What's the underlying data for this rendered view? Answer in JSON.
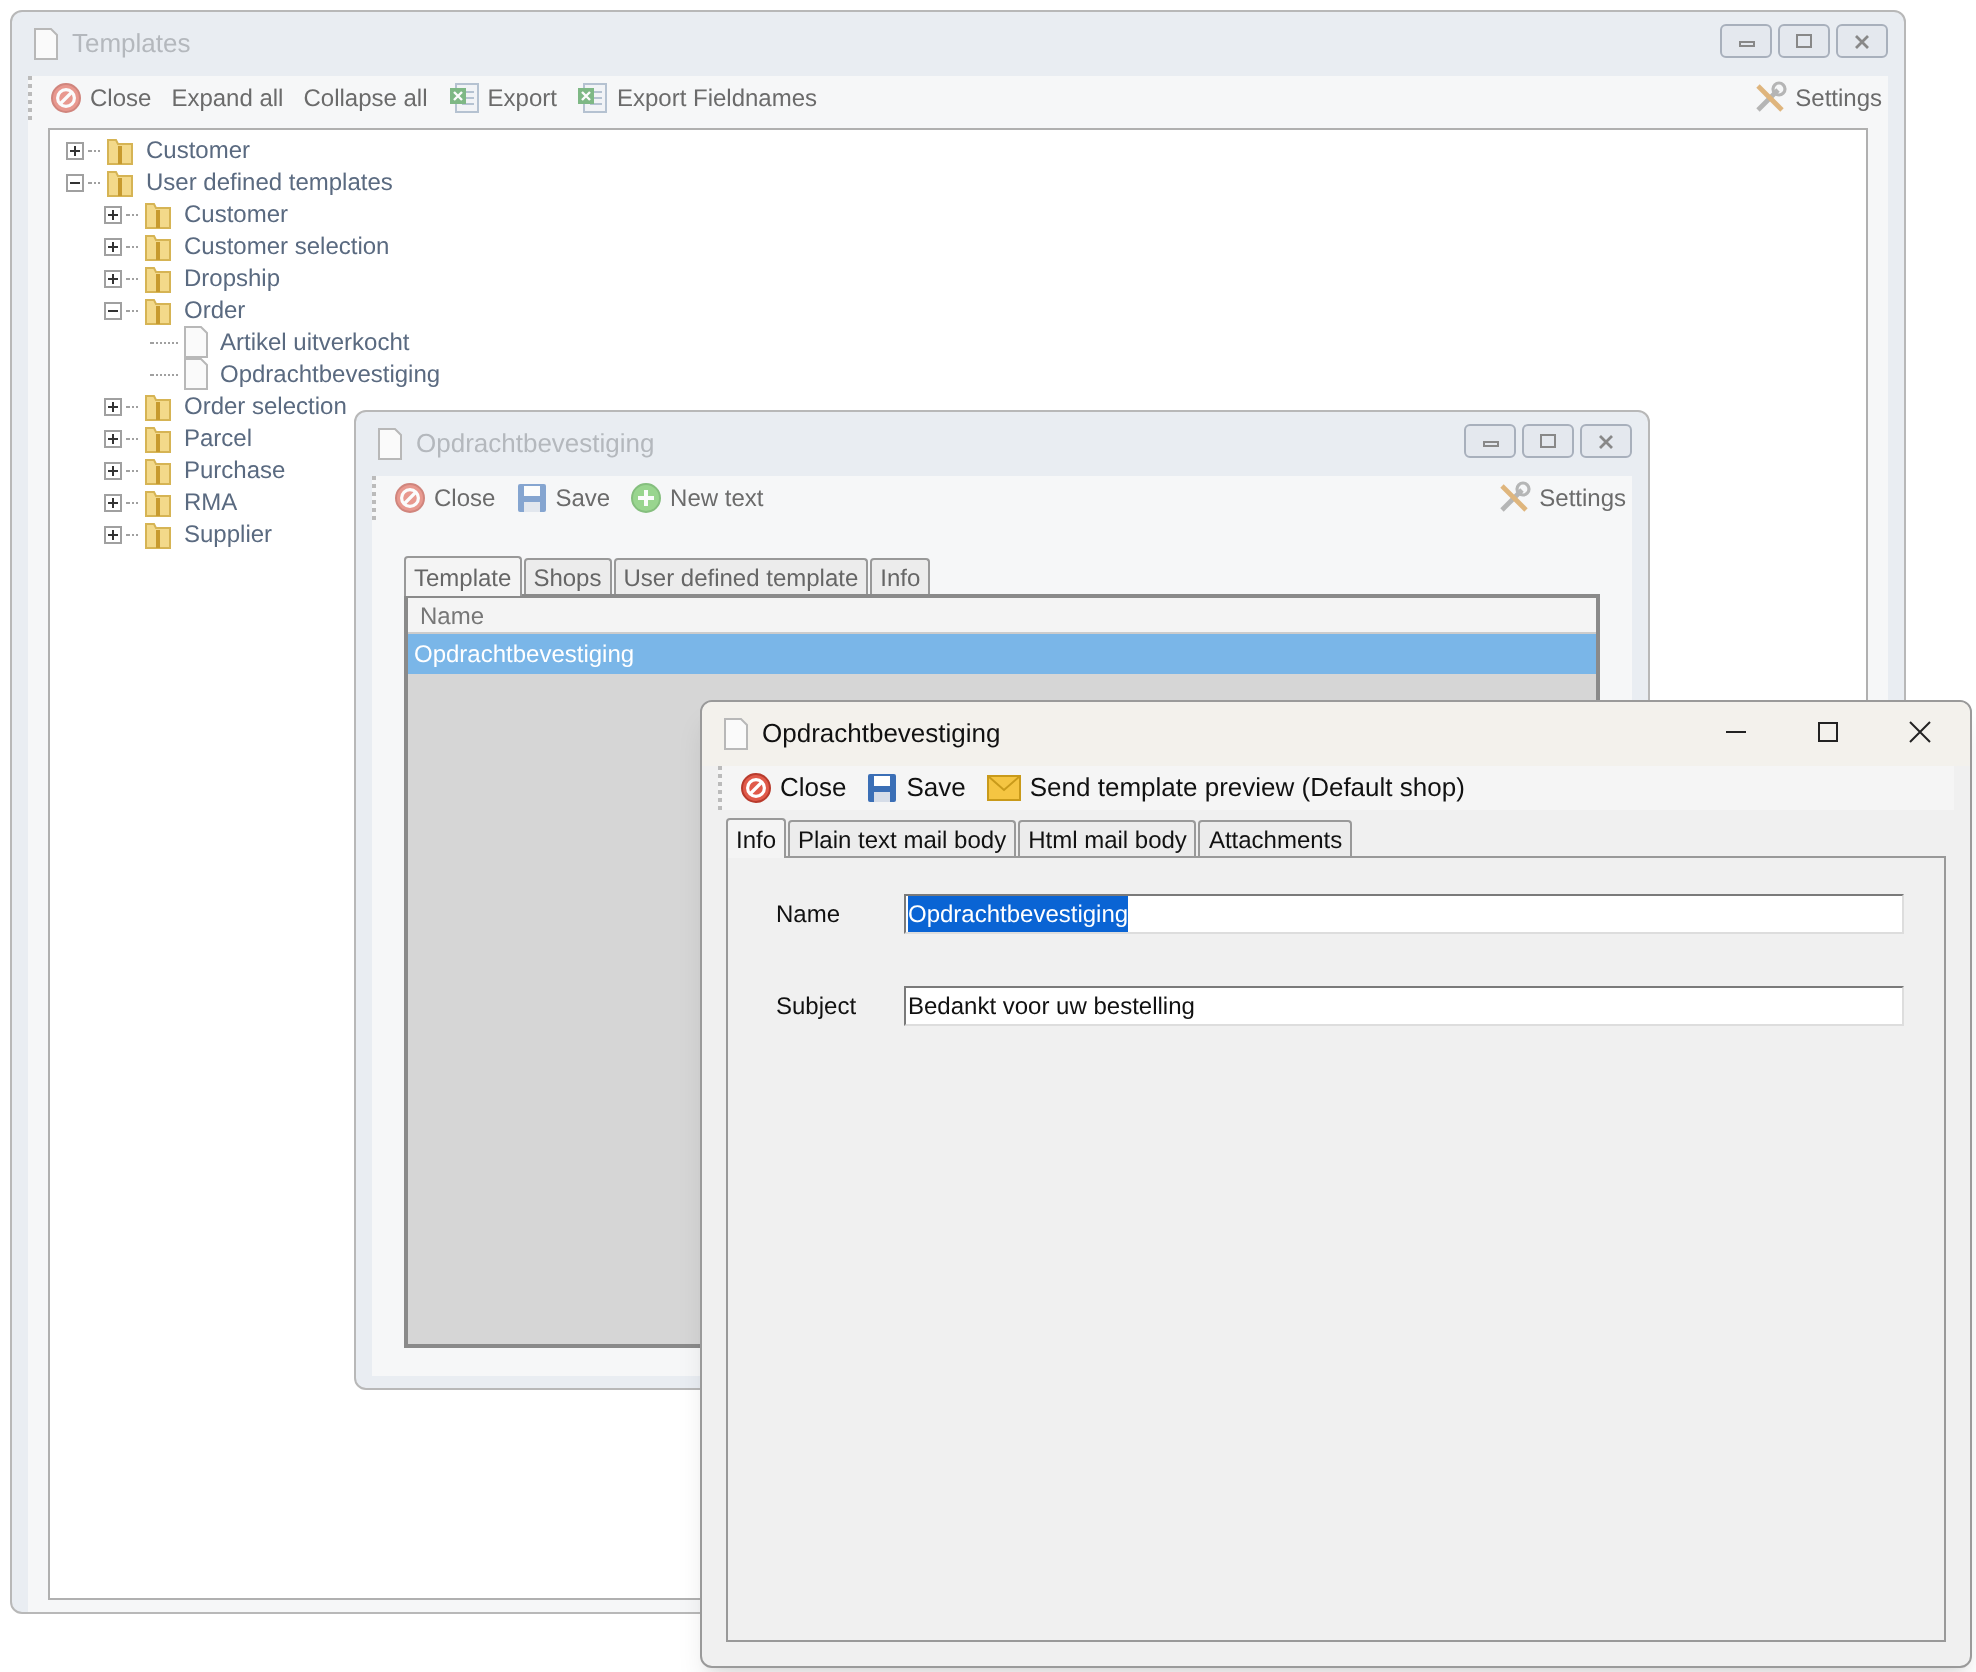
{
  "windows": [
    {
      "title": "Templates",
      "active": false,
      "toolbar": [
        {
          "kind": "close",
          "label": "Close"
        },
        {
          "kind": "text",
          "label": "Expand all"
        },
        {
          "kind": "text",
          "label": "Collapse all"
        },
        {
          "kind": "excel",
          "label": "Export"
        },
        {
          "kind": "excel",
          "label": "Export Fieldnames"
        }
      ],
      "settings": "Settings",
      "tree": [
        {
          "label": "Customer",
          "kind": "folder",
          "expanded": false
        },
        {
          "label": "User defined templates",
          "kind": "folder",
          "expanded": true,
          "children": [
            {
              "label": "Customer",
              "kind": "folder",
              "expanded": false
            },
            {
              "label": "Customer selection",
              "kind": "folder",
              "expanded": false
            },
            {
              "label": "Dropship",
              "kind": "folder",
              "expanded": false
            },
            {
              "label": "Order",
              "kind": "folder",
              "expanded": true,
              "children": [
                {
                  "label": "Artikel uitverkocht",
                  "kind": "document"
                },
                {
                  "label": "Opdrachtbevestiging",
                  "kind": "document"
                }
              ]
            },
            {
              "label": "Order selection",
              "kind": "folder",
              "expanded": false
            },
            {
              "label": "Parcel",
              "kind": "folder",
              "expanded": false
            },
            {
              "label": "Purchase",
              "kind": "folder",
              "expanded": false
            },
            {
              "label": "RMA",
              "kind": "folder",
              "expanded": false
            },
            {
              "label": "Supplier",
              "kind": "folder",
              "expanded": false
            }
          ]
        }
      ]
    },
    {
      "title": "Opdrachtbevestiging",
      "active": false,
      "toolbar": [
        {
          "kind": "close",
          "label": "Close"
        },
        {
          "kind": "save",
          "label": "Save"
        },
        {
          "kind": "add",
          "label": "New text"
        }
      ],
      "settings": "Settings",
      "tabs": [
        {
          "label": "Template",
          "selected": true
        },
        {
          "label": "Shops",
          "selected": false
        },
        {
          "label": "User defined template",
          "selected": false
        },
        {
          "label": "Info",
          "selected": false
        }
      ],
      "list": {
        "column": "Name",
        "rows": [
          {
            "label": "Opdrachtbevestiging",
            "selected": true
          }
        ]
      }
    },
    {
      "title": "Opdrachtbevestiging",
      "active": true,
      "toolbar": [
        {
          "kind": "close",
          "label": "Close"
        },
        {
          "kind": "save",
          "label": "Save"
        },
        {
          "kind": "mail",
          "label": "Send template preview (Default shop)"
        }
      ],
      "tabs": [
        {
          "label": "Info",
          "selected": true
        },
        {
          "label": "Plain text mail body",
          "selected": false
        },
        {
          "label": "Html mail body",
          "selected": false
        },
        {
          "label": "Attachments",
          "selected": false
        }
      ],
      "fields": [
        {
          "label": "Name",
          "value": "Opdrachtbevestiging",
          "text_selected": true
        },
        {
          "label": "Subject",
          "value": "Bedankt voor uw bestelling",
          "text_selected": false
        }
      ]
    }
  ]
}
